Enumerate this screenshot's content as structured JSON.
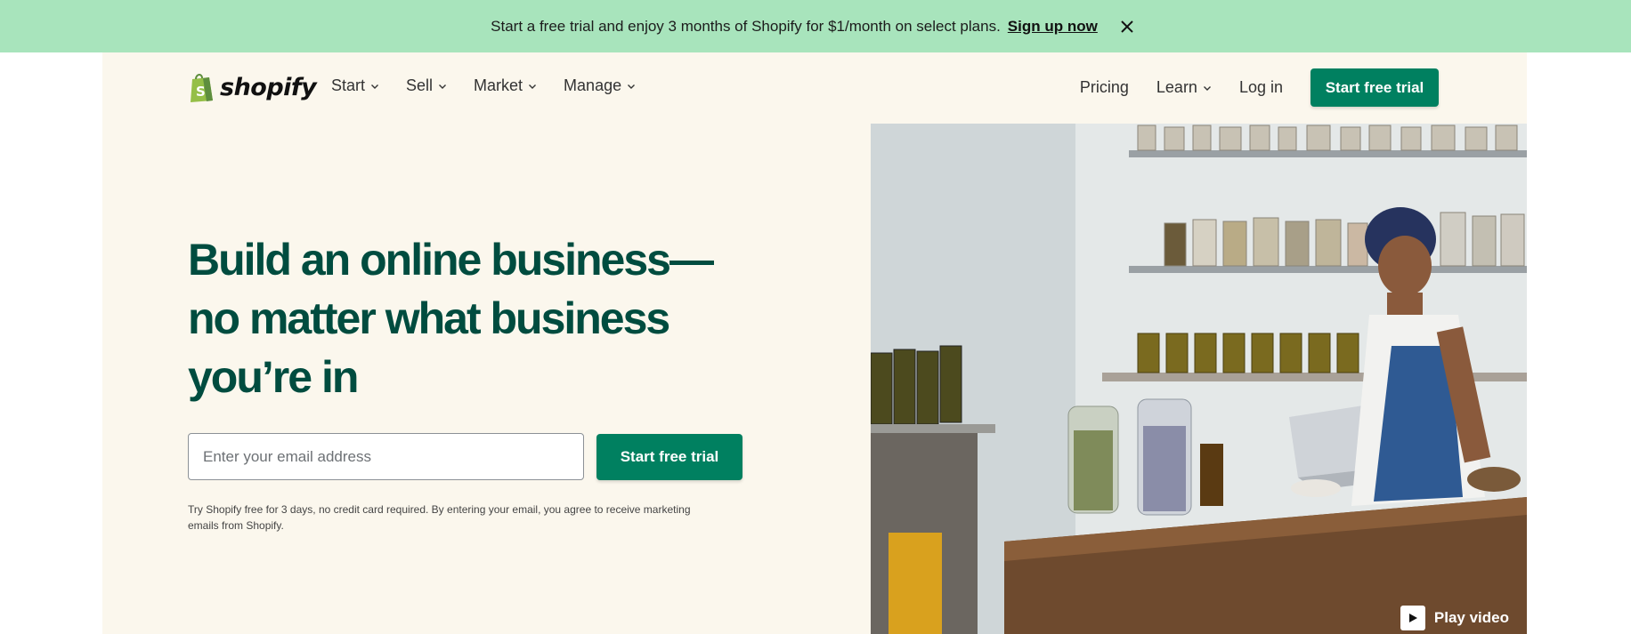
{
  "promo": {
    "text": "Start a free trial and enjoy 3 months of Shopify for $1/month on select plans.",
    "link": "Sign up now",
    "close_icon": "close-icon"
  },
  "header": {
    "logo_text": "shopify",
    "nav_left": [
      {
        "label": "Start"
      },
      {
        "label": "Sell"
      },
      {
        "label": "Market"
      },
      {
        "label": "Manage"
      }
    ],
    "pricing": "Pricing",
    "learn": "Learn",
    "login": "Log in",
    "cta": "Start free trial"
  },
  "hero": {
    "title_lines": [
      "Build an online business—",
      "no matter what business",
      "you’re in"
    ],
    "email_placeholder": "Enter your email address",
    "cta": "Start free trial",
    "disclaimer": "Try Shopify free for 3 days, no credit card required. By entering your email, you agree to receive marketing emails from Shopify.",
    "play_video": "Play video"
  },
  "colors": {
    "banner": "#a8e4bc",
    "cream": "#fbf7ed",
    "brand_green": "#008060",
    "headline": "#004c3f"
  }
}
